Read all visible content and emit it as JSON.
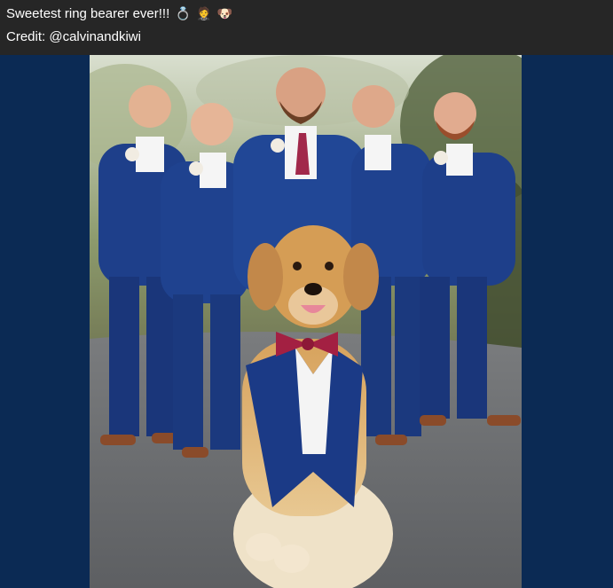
{
  "post": {
    "caption": "Sweetest ring bearer ever!!!",
    "caption_emojis": [
      "💍",
      "🤵",
      "🐶"
    ],
    "credit": "Credit: @calvinandkiwi"
  },
  "colors": {
    "caption_bar_bg": "#262626",
    "caption_text": "#ffffff",
    "page_bg": "#0b2a54"
  }
}
